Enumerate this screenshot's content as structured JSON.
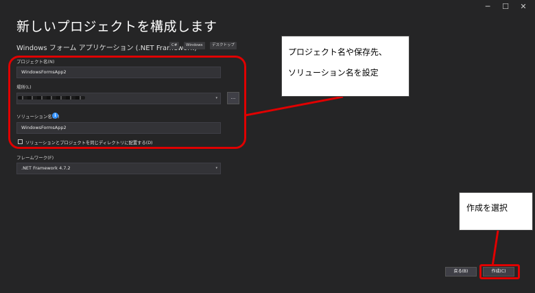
{
  "window": {
    "minimize_glyph": "─",
    "maximize_glyph": "☐",
    "close_glyph": "✕"
  },
  "page": {
    "title": "新しいプロジェクトを構成します",
    "template_name": "Windows フォーム アプリケーション (.NET Framework)",
    "tags": [
      "C#",
      "Windows",
      "デスクトップ"
    ]
  },
  "form": {
    "project_name_label": "プロジェクト名(N)",
    "project_name_value": "WindowsFormsApp2",
    "location_label": "場所(L)",
    "browse_label": "...",
    "solution_name_label": "ソリューション名(M)",
    "solution_name_value": "WindowsFormsApp2",
    "info_glyph": "i",
    "same_dir_label": "ソリューションとプロジェクトを同じディレクトリに配置する(D)",
    "framework_label": "フレームワーク(F)",
    "framework_value": ".NET Framework 4.7.2",
    "dropdown_glyph": "▾"
  },
  "buttons": {
    "back": "戻る(B)",
    "create": "作成(C)"
  },
  "annotations": {
    "callout1_line1": "プロジェクト名や保存先、",
    "callout1_line2": "ソリューション名を設定",
    "callout2": "作成を選択",
    "highlight_color": "#e00000"
  }
}
